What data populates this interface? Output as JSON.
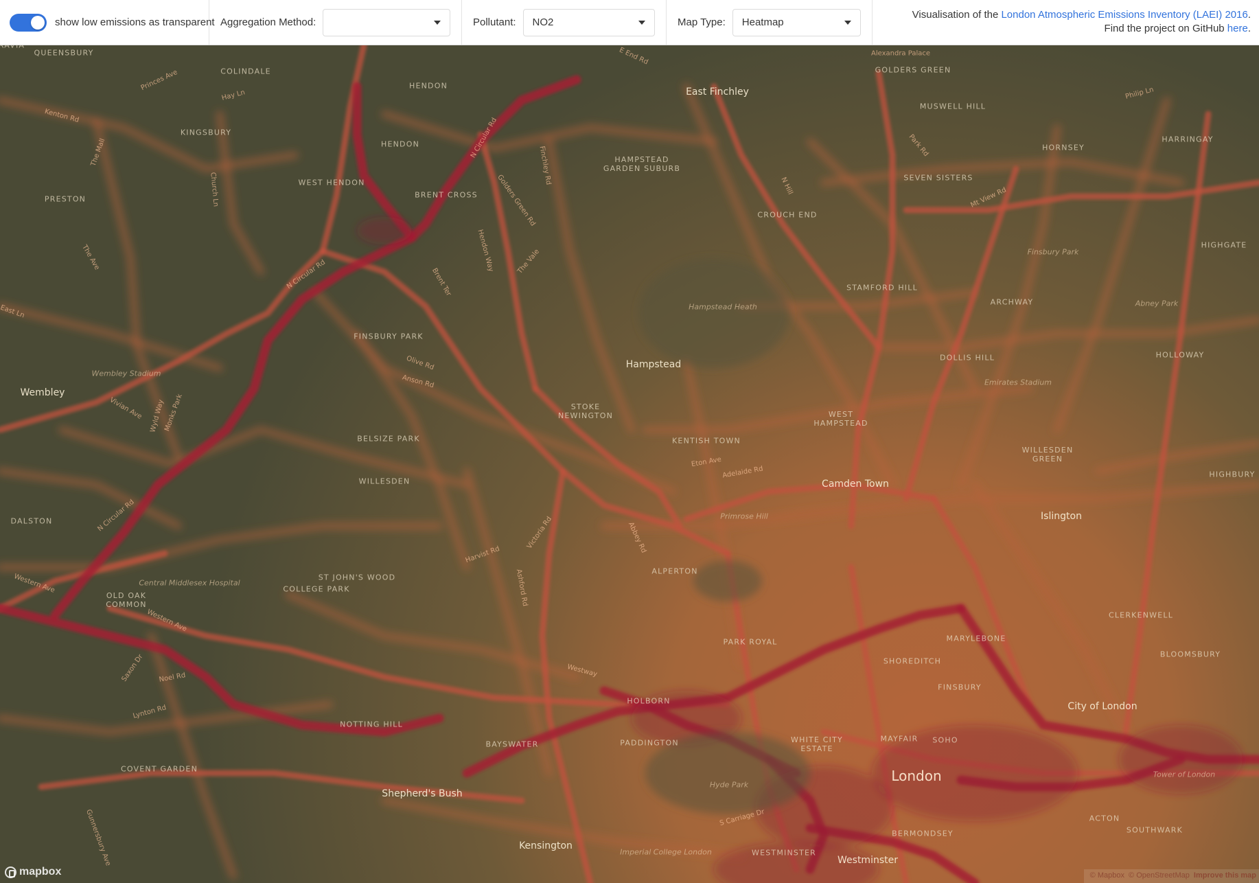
{
  "toolbar": {
    "toggle_on": true,
    "toggle_label": "show low emissions as transparent",
    "aggregation": {
      "label": "Aggregation Method:",
      "value": ""
    },
    "pollutant": {
      "label": "Pollutant:",
      "value": "NO2"
    },
    "map_type": {
      "label": "Map Type:",
      "value": "Heatmap"
    },
    "info": {
      "line1_prefix": "Visualisation of the ",
      "line1_link": "London Atmospheric Emissions Inventory (LAEI) 2016",
      "line1_suffix": ".",
      "line2_prefix": "Find the project on GitHub ",
      "line2_link": "here",
      "line2_suffix": "."
    },
    "accent_color": "#3273dc"
  },
  "map": {
    "colors": {
      "low": "#4a4a35",
      "mid": "#b06a3a",
      "high": "#8a1f35"
    },
    "places": {
      "large": [
        {
          "name": "London"
        }
      ],
      "medium": [
        {
          "name": "East Finchley"
        },
        {
          "name": "Hampstead"
        },
        {
          "name": "Wembley"
        },
        {
          "name": "Camden Town"
        },
        {
          "name": "Islington"
        },
        {
          "name": "City of London"
        },
        {
          "name": "Shepherd's Bush"
        },
        {
          "name": "Kensington"
        },
        {
          "name": "Westminster"
        }
      ],
      "small": [
        {
          "name": "QUEENSBURY"
        },
        {
          "name": "COLINDALE"
        },
        {
          "name": "HENDON"
        },
        {
          "name": "HENDON"
        },
        {
          "name": "KINGSBURY"
        },
        {
          "name": "PRESTON"
        },
        {
          "name": "WEST HENDON"
        },
        {
          "name": "BRENT CROSS"
        },
        {
          "name": "HAMPSTEAD GARDEN SUBURB"
        },
        {
          "name": "GOLDERS GREEN"
        },
        {
          "name": "MUSWELL HILL"
        },
        {
          "name": "HORNSEY"
        },
        {
          "name": "HARRINGAY"
        },
        {
          "name": "SEVEN SISTERS"
        },
        {
          "name": "CROUCH END"
        },
        {
          "name": "HIGHGATE"
        },
        {
          "name": "STAMFORD HILL"
        },
        {
          "name": "ARCHWAY"
        },
        {
          "name": "FINSBURY PARK"
        },
        {
          "name": "DOLLIS HILL"
        },
        {
          "name": "HOLLOWAY"
        },
        {
          "name": "STOKE NEWINGTON"
        },
        {
          "name": "WEST HAMPSTEAD"
        },
        {
          "name": "KENTISH TOWN"
        },
        {
          "name": "BELSIZE PARK"
        },
        {
          "name": "WILLESDEN"
        },
        {
          "name": "WILLESDEN GREEN"
        },
        {
          "name": "HIGHBURY"
        },
        {
          "name": "DALSTON"
        },
        {
          "name": "ALPERTON"
        },
        {
          "name": "ST JOHN'S WOOD"
        },
        {
          "name": "COLLEGE PARK"
        },
        {
          "name": "OLD OAK COMMON"
        },
        {
          "name": "PARK ROYAL"
        },
        {
          "name": "MARYLEBONE"
        },
        {
          "name": "CLERKENWELL"
        },
        {
          "name": "SHOREDITCH"
        },
        {
          "name": "BLOOMSBURY"
        },
        {
          "name": "FINSBURY"
        },
        {
          "name": "HOLBORN"
        },
        {
          "name": "PADDINGTON"
        },
        {
          "name": "BAYSWATER"
        },
        {
          "name": "NOTTING HILL"
        },
        {
          "name": "WHITE CITY ESTATE"
        },
        {
          "name": "MAYFAIR"
        },
        {
          "name": "SOHO"
        },
        {
          "name": "COVENT GARDEN"
        },
        {
          "name": "ACTON"
        },
        {
          "name": "SOUTHWARK"
        },
        {
          "name": "BERMONDSEY"
        },
        {
          "name": "WESTMINSTER"
        },
        {
          "name": "BELGRAVIA"
        }
      ],
      "roads": [
        {
          "name": "Princes Ave"
        },
        {
          "name": "Hay Ln"
        },
        {
          "name": "Kenton Rd"
        },
        {
          "name": "The Mall"
        },
        {
          "name": "Church Ln"
        },
        {
          "name": "The Ave"
        },
        {
          "name": "East Ln"
        },
        {
          "name": "N Circular Rd"
        },
        {
          "name": "N Circular Rd"
        },
        {
          "name": "N Circular Rd"
        },
        {
          "name": "Finchley Rd"
        },
        {
          "name": "Golders Green Rd"
        },
        {
          "name": "Hendon Way"
        },
        {
          "name": "The Vale"
        },
        {
          "name": "Brent Ter"
        },
        {
          "name": "Olive Rd"
        },
        {
          "name": "Anson Rd"
        },
        {
          "name": "Vivian Ave"
        },
        {
          "name": "Wyld Way"
        },
        {
          "name": "Monks Park"
        },
        {
          "name": "Western Ave"
        },
        {
          "name": "Western Ave"
        },
        {
          "name": "Noel Rd"
        },
        {
          "name": "Saxon Dr"
        },
        {
          "name": "Lynton Rd"
        },
        {
          "name": "Harvist Rd"
        },
        {
          "name": "Victoria Rd"
        },
        {
          "name": "Abbey Rd"
        },
        {
          "name": "Westway"
        },
        {
          "name": "Eton Ave"
        },
        {
          "name": "Adelaide Rd"
        },
        {
          "name": "Park Rd"
        },
        {
          "name": "N Hill"
        },
        {
          "name": "Mt View Rd"
        },
        {
          "name": "Philip Ln"
        },
        {
          "name": "Alexandra Palace"
        },
        {
          "name": "Ashford Rd"
        },
        {
          "name": "S Carriage Dr"
        },
        {
          "name": "Gunnersbury Ave"
        },
        {
          "name": "E End Rd"
        }
      ],
      "parks": [
        {
          "name": "Hampstead Heath"
        },
        {
          "name": "Wembley Stadium"
        },
        {
          "name": "Finsbury Park"
        },
        {
          "name": "Emirates Stadium"
        },
        {
          "name": "Abney Park"
        },
        {
          "name": "Primrose Hill"
        },
        {
          "name": "Central Middlesex Hospital"
        },
        {
          "name": "Hyde Park"
        },
        {
          "name": "Imperial College London"
        },
        {
          "name": "Tower of London"
        }
      ]
    },
    "logo_text": "mapbox",
    "attribution": {
      "mapbox": "© Mapbox",
      "osm": "© OpenStreetMap",
      "improve": "Improve this map"
    }
  }
}
